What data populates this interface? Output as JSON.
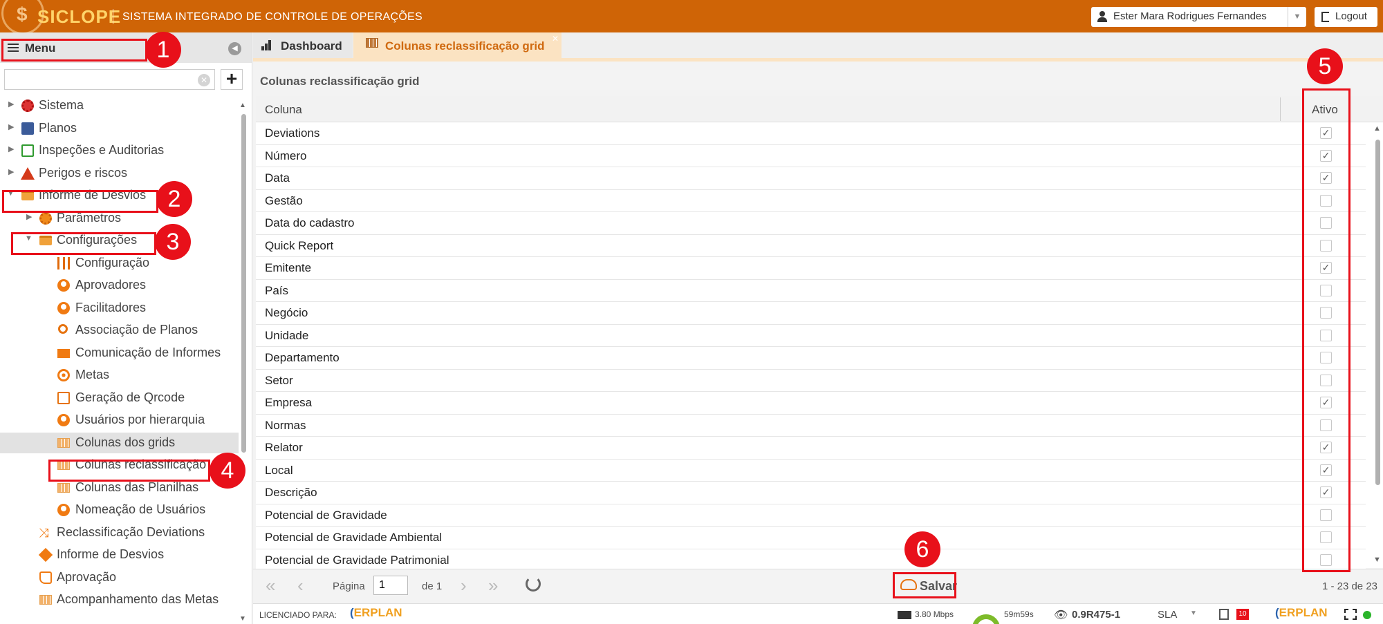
{
  "header": {
    "logo": "SICLOPE",
    "subtitle": "SISTEMA INTEGRADO DE CONTROLE DE OPERAÇÕES",
    "user_name": "Ester Mara Rodrigues Fernandes",
    "logout_label": "Logout",
    "brand_color": "#cf6406"
  },
  "sidebar": {
    "menu_label": "Menu",
    "search_placeholder": "",
    "items": [
      {
        "label": "Sistema",
        "icon": "gear-icon"
      },
      {
        "label": "Planos",
        "icon": "plan-icon"
      },
      {
        "label": "Inspeções e Auditorias",
        "icon": "clipboard-icon"
      },
      {
        "label": "Perigos e riscos",
        "icon": "warning-icon"
      },
      {
        "label": "Informe de Desvios",
        "icon": "folder-open-icon"
      },
      {
        "label": "Parâmetros",
        "icon": "gear-icon"
      },
      {
        "label": "Configurações",
        "icon": "folder-open-icon"
      },
      {
        "label": "Configuração",
        "icon": "sliders-icon"
      },
      {
        "label": "Aprovadores",
        "icon": "user-icon"
      },
      {
        "label": "Facilitadores",
        "icon": "user-icon"
      },
      {
        "label": "Associação de Planos",
        "icon": "search-icon"
      },
      {
        "label": "Comunicação de Informes",
        "icon": "mail-icon"
      },
      {
        "label": "Metas",
        "icon": "target-icon"
      },
      {
        "label": "Geração de Qrcode",
        "icon": "document-icon"
      },
      {
        "label": "Usuários por hierarquia",
        "icon": "user-icon"
      },
      {
        "label": "Colunas dos grids",
        "icon": "grid-icon"
      },
      {
        "label": "Colunas reclassificação",
        "icon": "grid-icon"
      },
      {
        "label": "Colunas das Planilhas",
        "icon": "grid-icon"
      },
      {
        "label": "Nomeação de Usuários",
        "icon": "user-icon"
      },
      {
        "label": "Reclassificação Deviations",
        "icon": "shuffle-icon"
      },
      {
        "label": "Informe de Desvios",
        "icon": "diamond-icon"
      },
      {
        "label": "Aprovação",
        "icon": "thumbs-up-icon"
      },
      {
        "label": "Acompanhamento das Metas",
        "icon": "grid-icon"
      }
    ]
  },
  "tabs": [
    {
      "label": "Dashboard",
      "icon": "bar-chart-icon"
    },
    {
      "label": "Colunas reclassificação grid",
      "icon": "grid-icon"
    }
  ],
  "panel": {
    "title": "Colunas reclassificação grid",
    "col_header": "Coluna",
    "active_header": "Ativo",
    "rows": [
      {
        "name": "Deviations",
        "active": true
      },
      {
        "name": "Número",
        "active": true
      },
      {
        "name": "Data",
        "active": true
      },
      {
        "name": "Gestão",
        "active": false
      },
      {
        "name": "Data do cadastro",
        "active": false
      },
      {
        "name": "Quick Report",
        "active": false
      },
      {
        "name": "Emitente",
        "active": true
      },
      {
        "name": "País",
        "active": false
      },
      {
        "name": "Negócio",
        "active": false
      },
      {
        "name": "Unidade",
        "active": false
      },
      {
        "name": "Departamento",
        "active": false
      },
      {
        "name": "Setor",
        "active": false
      },
      {
        "name": "Empresa",
        "active": true
      },
      {
        "name": "Normas",
        "active": false
      },
      {
        "name": "Relator",
        "active": true
      },
      {
        "name": "Local",
        "active": true
      },
      {
        "name": "Descrição",
        "active": true
      },
      {
        "name": "Potencial de Gravidade",
        "active": false
      },
      {
        "name": "Potencial de Gravidade Ambiental",
        "active": false
      },
      {
        "name": "Potencial de Gravidade Patrimonial",
        "active": false
      }
    ]
  },
  "pager": {
    "page_label": "Página",
    "page_value": "1",
    "of_label": "de 1",
    "save_label": "Salvar",
    "count": "1 - 23 de 23"
  },
  "footer": {
    "licensed_label": "LICENCIADO PARA:",
    "brand_c": "(",
    "brand_name": "ERPLAN",
    "speed": "3.80 Mbps",
    "timer": "59m59s",
    "version": "0.9R475-1",
    "sla": "SLA",
    "notif_count": "10"
  },
  "annotations": [
    "1",
    "2",
    "3",
    "4",
    "5",
    "6"
  ]
}
